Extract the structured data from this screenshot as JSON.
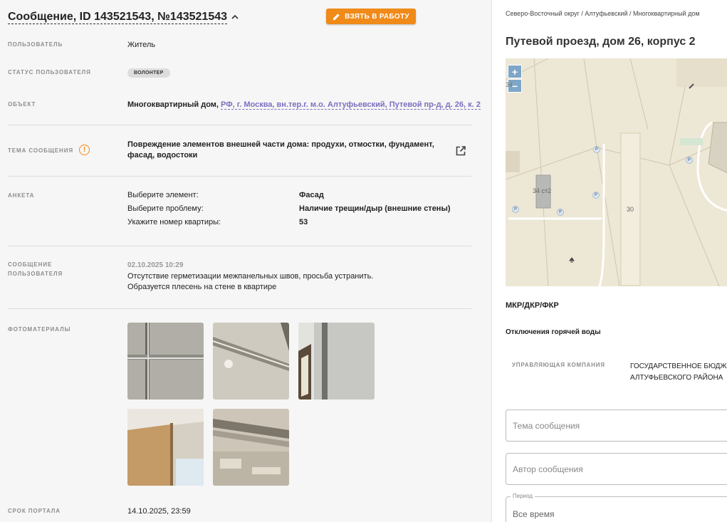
{
  "header": {
    "title": "Сообщение, ID 143521543, №143521543",
    "take_button": "ВЗЯТЬ В РАБОТУ"
  },
  "fields": {
    "user_label": "ПОЛЬЗОВАТЕЛЬ",
    "user_value": "Житель",
    "user_status_label": "СТАТУС ПОЛЬЗОВАТЕЛЯ",
    "user_status_badge": "ВОЛОНТЕР",
    "object_label": "ОБЪЕКТ",
    "object_type": "Многоквартирный дом,",
    "object_address": "РФ, г. Москва, вн.тер.г. м.о. Алтуфьевский, Путевой пр-д, д. 26, к. 2",
    "topic_label": "ТЕМА СООБЩЕНИЯ",
    "topic_line1": "Повреждение элементов внешней части дома: продухи, отмостки, фундамент,",
    "topic_line2": "фасад, водостоки",
    "survey_label": "АНКЕТА",
    "survey": [
      {
        "q": "Выберите элемент:",
        "a": "Фасад"
      },
      {
        "q": "Выберите проблему:",
        "a": "Наличие трещин/дыр (внешние стены)"
      },
      {
        "q": "Укажите номер квартиры:",
        "a": "53"
      }
    ],
    "message_label_1": "СООБЩЕНИЕ",
    "message_label_2": "ПОЛЬЗОВАТЕЛЯ",
    "message_date": "02.10.2025 10:29",
    "message_line1": "Отсутствие герметизации межпанельных швов, просьба устранить.",
    "message_line2": "Образуется плесень на стене в квартире",
    "photos_label": "ФОТОМАТЕРИАЛЫ",
    "deadline_label": "СРОК ПОРТАЛА",
    "deadline_value": "14.10.2025, 23:59"
  },
  "right": {
    "breadcrumb": "Северо-Восточный округ / Алтуфьевский / Многоквартирный дом",
    "address": "Путевой проезд, дом 26, корпус 2",
    "map": {
      "zoom_in": "+",
      "zoom_out": "−",
      "label_34": "34",
      "label_34st2": "34 ст2",
      "label_30": "30",
      "parking": "P"
    },
    "mkr": "МКР/ДКР/ФКР",
    "hot_water": "Отключения горячей воды",
    "mgmt_label": "УПРАВЛЯЮЩАЯ КОМПАНИЯ",
    "mgmt_line1": "ГОСУДАРСТВЕННОЕ БЮДЖЕТНОЕ УЧРЕЖДЕНИЕ",
    "mgmt_line2": "АЛТУФЬЕВСКОГО РАЙОНА",
    "topic_placeholder": "Тема сообщения",
    "author_placeholder": "Автор сообщения",
    "period_legend": "Период",
    "period_value": "Все время"
  },
  "colors": {
    "accent": "#f08a19",
    "link": "#7b6fc0",
    "map_bg": "#ede7d5",
    "zoom": "#7ea6c8"
  }
}
